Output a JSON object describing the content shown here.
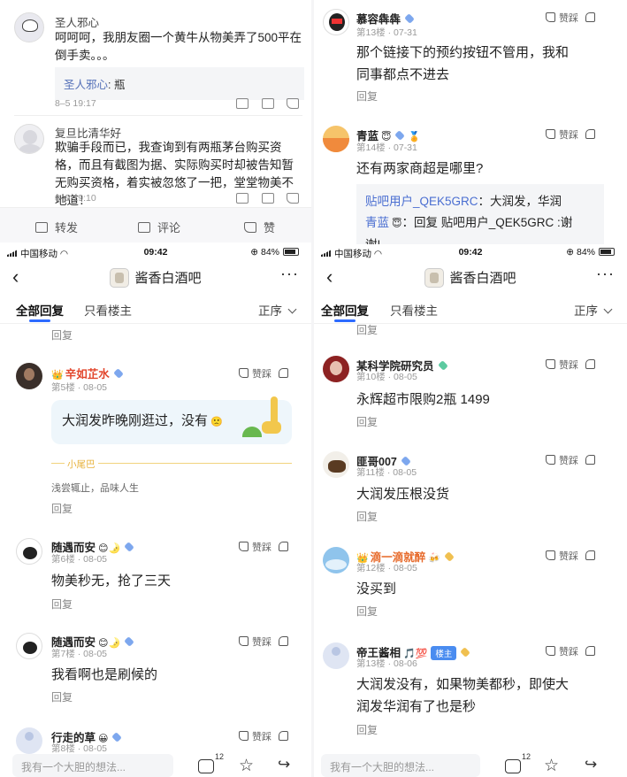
{
  "tl": {
    "comments": [
      {
        "name": "圣人邪心",
        "text": "呵呵呵，我朋友圈一个黄牛从物美弄了500平在倒手卖。。。",
        "quote_name": "圣人邪心",
        "quote_text": "瓶",
        "time": "8–5 19:17"
      },
      {
        "name": "复旦比清华好",
        "text": "欺骗手段而已，我查询到有两瓶茅台购买资格，而且有截图为据、实际购买时却被告知暂无购买资格，着实被忽悠了一把，堂堂物美不地道！",
        "time": "8–5 19:10"
      }
    ],
    "actions": {
      "forward": "转发",
      "comment": "评论",
      "like": "赞"
    }
  },
  "tr": {
    "posts": [
      {
        "name": "慕容犇犇",
        "meta": "第13楼 · 07-31",
        "text_lines": [
          "那个链接下的预约按钮不管用，我和",
          "同事都点不进去"
        ],
        "reply": "回复",
        "likes": "赞踩"
      },
      {
        "name": "青蓝",
        "meta": "第14楼 · 07-31",
        "text_lines": [
          "还有两家商超是哪里?"
        ],
        "likes": "赞踩",
        "quote_line1_name": "贴吧用户_QEK5GRC",
        "quote_line1_text": "：大润发，华润",
        "quote_line2_name": "青蓝",
        "quote_line2_text": "：回复 贴吧用户_QEK5GRC :谢",
        "quote_line3": "谢!"
      }
    ]
  },
  "phone": {
    "carrier": "中国移动",
    "time": "09:42",
    "battery": "84%",
    "title": "酱香白酒吧",
    "tab_all": "全部回复",
    "tab_owner": "只看楼主",
    "sort": "正序",
    "input_placeholder": "我有一个大胆的想法...",
    "comment_count": "12"
  },
  "bl": {
    "top_reply": "回复",
    "posts": [
      {
        "name": "辛如芷水",
        "meta": "第5楼 · 08-05",
        "bubble": "大润发昨晚刚逛过，没有",
        "tail": "小尾巴",
        "signature": "浅尝辄止，品味人生",
        "reply": "回复",
        "likes": "赞踩"
      },
      {
        "name": "随遇而安",
        "meta": "第6楼 · 08-05",
        "text": "物美秒无，抢了三天",
        "reply": "回复",
        "likes": "赞踩"
      },
      {
        "name": "随遇而安",
        "meta": "第7楼 · 08-05",
        "text": "我看啊也是刷候的",
        "reply": "回复",
        "likes": "赞踩"
      },
      {
        "name": "行走的草",
        "meta": "第8楼 · 08-05",
        "likes": "赞踩"
      }
    ]
  },
  "br": {
    "top_reply": "回复",
    "posts": [
      {
        "name": "某科学院研究员",
        "meta": "第10楼 · 08-05",
        "text": "永辉超市限购2瓶 1499",
        "reply": "回复",
        "likes": "赞踩"
      },
      {
        "name": "匪哥007",
        "meta": "第11楼 · 08-05",
        "text": "大润发压根没货",
        "reply": "回复",
        "likes": "赞踩"
      },
      {
        "name": "滴一滴就醉",
        "meta": "第12楼 · 08-05",
        "text": "没买到",
        "reply": "回复",
        "likes": "赞踩"
      },
      {
        "name": "帝王酱相",
        "badge": "楼主",
        "meta": "第13楼 · 08-06",
        "text_lines": [
          "大润发没有，如果物美都秒，即使大",
          "润发华润有了也是秒"
        ],
        "reply": "回复",
        "likes": "赞踩"
      }
    ]
  },
  "colors": {
    "accent": "#2d6bff",
    "link": "#4a6ed1",
    "red_name": "#e2452b"
  }
}
